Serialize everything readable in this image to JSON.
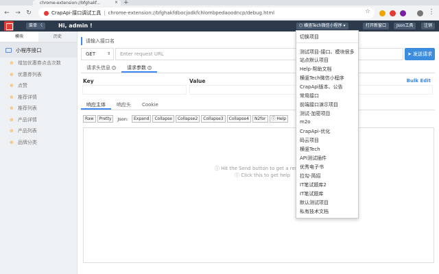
{
  "browser": {
    "tab_title": "chrome-extension://bfghakf...",
    "page_title": "CrapApi-接口调试工具",
    "url": "chrome-extension://bfghakfdbocjodkfchlombpedaoodncp/debug.html"
  },
  "header": {
    "menu_label": "菜单 〈",
    "greeting": "Hi, admin !",
    "project_select": "⬡ 横竖Tech微信小程序 ▾",
    "open_new_window": "打开新窗口",
    "json_tool": "Json工具",
    "logout": "注销"
  },
  "sidebar": {
    "tabs": [
      "模块",
      "历史"
    ],
    "group": "小程序接口",
    "items": [
      "增加优惠券点击次数",
      "优惠券列表",
      "点赞",
      "推荐详情",
      "推荐列表",
      "产品详情",
      "产品列表",
      "品牌分类"
    ]
  },
  "request": {
    "name_placeholder": "请输入接口名",
    "method": "GET",
    "url_placeholder": "Enter request URL",
    "send_label": "➤ 发送请求",
    "tabs": [
      "请求头信息",
      "请求参数"
    ],
    "params_header": {
      "key": "Key",
      "value": "Value",
      "bulk_edit": "Bulk Edit"
    }
  },
  "response": {
    "tabs": [
      "响应主体",
      "响应头",
      "Cookie"
    ],
    "toolbar_buttons_left": [
      "Raw",
      "Pretty"
    ],
    "json_label": "Json:",
    "toolbar_buttons_right": [
      "Expand",
      "Collapse",
      "Collapse2",
      "Collapse3",
      "Collapse4",
      "N2for",
      "ⓘ Help"
    ],
    "hint_send": "ⓘ Hit the Send button to get a respo",
    "hint_click": "ⓘ Click this to get help"
  },
  "dropdown": {
    "header": "切换项目",
    "items": [
      "测试项目-接口、模块很多",
      "站点默认项目",
      "Help-帮助文档",
      "横竖Tech微信小程序",
      "CrapApi版本、公告",
      "常用接口",
      "前端接口演示项目",
      "测试-加密项目",
      "m2o",
      "CrapApi-优化",
      "码云项目",
      "横竖Tech",
      "API测试插件",
      "优秀电子书",
      "拉勾-简招",
      "IT笔试题库2",
      "IT笔试题库",
      "默认测试项目",
      "私有技术文档"
    ]
  },
  "colors": {
    "header_bg": "#2d3a4b",
    "accent": "#3c89f5",
    "logo": "#e53935"
  }
}
